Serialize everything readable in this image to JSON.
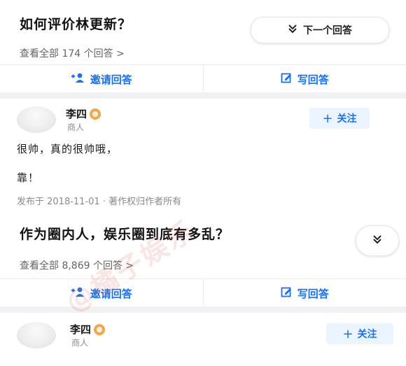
{
  "question1": {
    "title": "如何评价林更新？",
    "view_all": "查看全部 174 个回答 >",
    "next_label": "下一个回答",
    "invite_label": "邀请回答",
    "write_label": "写回答"
  },
  "answer1": {
    "author": "李四",
    "author_title": "商人",
    "follow_label": "关注",
    "line1": "很帅，真的很帅哦，",
    "line2": "靠！",
    "meta": "发布于 2018-11-01 · 著作权归作者所有"
  },
  "question2": {
    "title": "作为圈内人，娱乐圈到底有多乱？",
    "view_all": "查看全部 8,869 个回答 >",
    "invite_label": "邀请回答",
    "write_label": "写回答"
  },
  "answer2": {
    "author": "李四",
    "author_title": "商人",
    "follow_label": "关注"
  },
  "watermark": "@橘子娱乐",
  "colors": {
    "accent": "#1772f6",
    "divider": "#f1f1f3",
    "badge": "#f3a64a"
  }
}
